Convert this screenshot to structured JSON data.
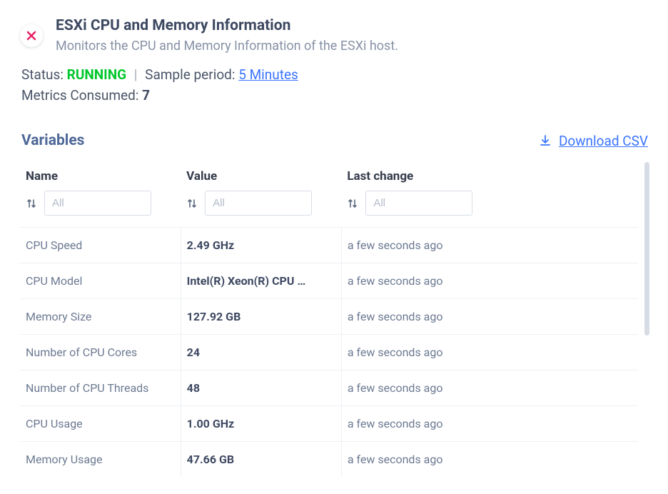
{
  "header": {
    "title": "ESXi CPU and Memory Information",
    "subtitle": "Monitors the CPU and Memory Information of the ESXi host."
  },
  "status": {
    "label": "Status:",
    "value": "RUNNING",
    "sample_label": "Sample period:",
    "sample_value": "5 Minutes",
    "metrics_label": "Metrics Consumed:",
    "metrics_value": "7"
  },
  "variables": {
    "title": "Variables",
    "download_label": "Download CSV"
  },
  "table": {
    "columns": {
      "name": "Name",
      "value": "Value",
      "last": "Last change"
    },
    "filter_placeholder": "All",
    "rows": [
      {
        "name": "CPU Speed",
        "value": "2.49 GHz",
        "last": "a few seconds ago"
      },
      {
        "name": "CPU Model",
        "value": "Intel(R) Xeon(R) CPU …",
        "last": "a few seconds ago"
      },
      {
        "name": "Memory Size",
        "value": "127.92 GB",
        "last": "a few seconds ago"
      },
      {
        "name": "Number of CPU Cores",
        "value": "24",
        "last": "a few seconds ago"
      },
      {
        "name": "Number of CPU Threads",
        "value": "48",
        "last": "a few seconds ago"
      },
      {
        "name": "CPU Usage",
        "value": "1.00 GHz",
        "last": "a few seconds ago"
      },
      {
        "name": "Memory Usage",
        "value": "47.66 GB",
        "last": "a few seconds ago"
      }
    ]
  }
}
